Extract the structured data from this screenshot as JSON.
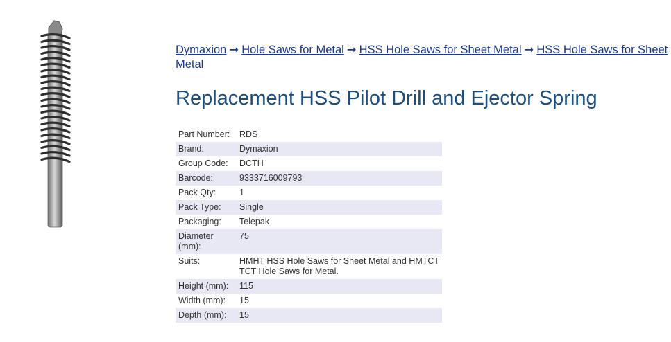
{
  "breadcrumb": {
    "items": [
      "Dymaxion",
      "Hole Saws for Metal",
      "HSS Hole Saws for Sheet Metal",
      "HSS Hole Saws for Sheet Metal"
    ],
    "separator": "➞"
  },
  "product": {
    "title": "Replacement HSS Pilot Drill and Ejector Spring",
    "image_icon": "pilot-drill-with-spring"
  },
  "specs": [
    {
      "label": "Part Number:",
      "value": "RDS"
    },
    {
      "label": "Brand:",
      "value": "Dymaxion"
    },
    {
      "label": "Group Code:",
      "value": "DCTH"
    },
    {
      "label": "Barcode:",
      "value": "9333716009793"
    },
    {
      "label": "Pack Qty:",
      "value": "1"
    },
    {
      "label": "Pack Type:",
      "value": "Single"
    },
    {
      "label": "Packaging:",
      "value": "Telepak"
    },
    {
      "label": "Diameter (mm):",
      "value": "75"
    },
    {
      "label": "Suits:",
      "value": "HMHT HSS Hole Saws for Sheet Metal and HMTCT TCT Hole Saws for Metal."
    },
    {
      "label": "Height (mm):",
      "value": "115"
    },
    {
      "label": "Width (mm):",
      "value": "15"
    },
    {
      "label": "Depth (mm):",
      "value": "15"
    }
  ],
  "colors": {
    "link": "#1a3a8a",
    "title": "#1d4e7e",
    "row_shade": "#e7e8f4",
    "text": "#333333"
  }
}
